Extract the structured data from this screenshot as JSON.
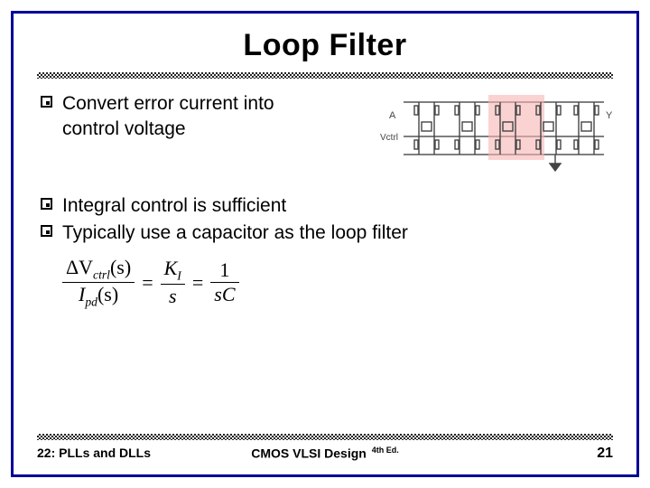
{
  "title": "Loop Filter",
  "bullets": {
    "b1": "Convert error current into control voltage",
    "b2": "Integral control is sufficient",
    "b3": "Typically use a capacitor as the loop filter"
  },
  "circuit": {
    "labels": {
      "A": "A",
      "Y": "Y",
      "Vctrl": "Vctrl"
    }
  },
  "formula": {
    "num1_a": "ΔV",
    "num1_sub": "ctrl",
    "num1_b": "(s)",
    "den1_a": "I",
    "den1_sub": "pd",
    "den1_b": "(s)",
    "eq1": "=",
    "num2": "K",
    "num2_sub": "I",
    "den2": "s",
    "eq2": "=",
    "num3": "1",
    "den3": "sC"
  },
  "footer": {
    "left": "22: PLLs and DLLs",
    "center": "CMOS VLSI Design",
    "edition": "4th Ed.",
    "page": "21"
  }
}
